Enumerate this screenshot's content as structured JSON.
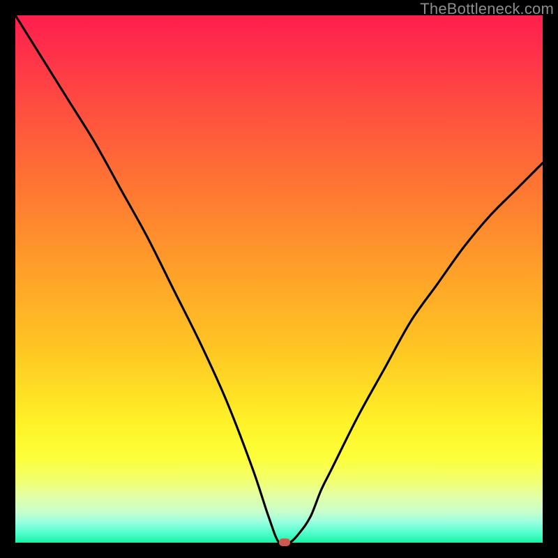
{
  "watermark": "TheBottleneck.com",
  "colors": {
    "frame": "#000000",
    "gradient_top": "#ff1f4e",
    "gradient_bottom": "#18f2a6",
    "curve": "#000000",
    "marker": "#d0594e",
    "watermark": "#8d8d8d"
  },
  "chart_data": {
    "type": "line",
    "title": "",
    "xlabel": "",
    "ylabel": "",
    "xlim": [
      0,
      100
    ],
    "ylim": [
      0,
      100
    ],
    "x": [
      0,
      5,
      10,
      15,
      20,
      25,
      30,
      35,
      40,
      45,
      48,
      50,
      52,
      54,
      56,
      58,
      60,
      65,
      70,
      75,
      80,
      85,
      90,
      95,
      100
    ],
    "values": [
      100,
      92,
      84,
      76,
      67,
      58,
      48,
      38,
      27,
      14,
      5,
      0,
      0,
      2,
      5,
      10,
      14,
      24,
      33,
      42,
      49,
      56,
      62,
      67,
      72
    ],
    "marker": {
      "x": 51,
      "y": 0
    },
    "grid": false,
    "legend": false,
    "annotations": []
  }
}
